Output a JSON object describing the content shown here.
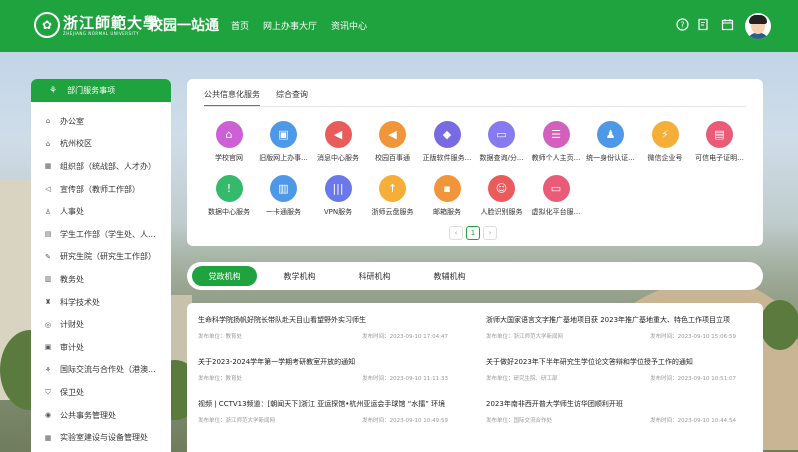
{
  "header": {
    "university_name": "浙江師範大學",
    "university_en": "ZHEJIANG NORMAL UNIVERSITY",
    "portal_title": "校园一站通",
    "nav": [
      "首页",
      "网上办事大厅",
      "资讯中心"
    ],
    "icons": [
      "help-icon",
      "edit-doc-icon",
      "calendar-icon"
    ]
  },
  "sidebar": {
    "title": "部门服务事项",
    "items": [
      {
        "label": "办公室",
        "icon": "home-icon"
      },
      {
        "label": "杭州校区",
        "icon": "campus-icon"
      },
      {
        "label": "组织部（统战部、人才办）",
        "icon": "org-icon"
      },
      {
        "label": "宣传部（教师工作部）",
        "icon": "megaphone-icon"
      },
      {
        "label": "人事处",
        "icon": "person-icon"
      },
      {
        "label": "学生工作部（学生处、人...",
        "icon": "student-icon"
      },
      {
        "label": "研究生院（研究生工作部）",
        "icon": "graduate-icon"
      },
      {
        "label": "教务处",
        "icon": "book-icon"
      },
      {
        "label": "科学技术处",
        "icon": "flask-icon"
      },
      {
        "label": "计财处",
        "icon": "finance-icon"
      },
      {
        "label": "审计处",
        "icon": "audit-icon"
      },
      {
        "label": "国际交流与合作处（港澳...",
        "icon": "globe-icon"
      },
      {
        "label": "保卫处",
        "icon": "shield-icon"
      },
      {
        "label": "公共事务管理处",
        "icon": "public-icon"
      },
      {
        "label": "实验室建设与设备管理处",
        "icon": "lab-icon"
      }
    ]
  },
  "services": {
    "tabs": [
      "公共信息化服务",
      "综合查询"
    ],
    "items": [
      {
        "label": "学校官网",
        "color": "#c84fd0",
        "icon": "school-icon"
      },
      {
        "label": "旧版网上办事...",
        "color": "#3a8ee6",
        "icon": "briefcase-icon"
      },
      {
        "label": "消息中心服务",
        "color": "#e84a4a",
        "icon": "megaphone-icon"
      },
      {
        "label": "校园百事通",
        "color": "#f08a24",
        "icon": "announce-icon"
      },
      {
        "label": "正版软件服务...",
        "color": "#6a5ae0",
        "icon": "cube-icon"
      },
      {
        "label": "数据查询/分...",
        "color": "#7b6cf0",
        "icon": "tv-icon"
      },
      {
        "label": "教师个人主页...",
        "color": "#d04fb8",
        "icon": "profile-icon"
      },
      {
        "label": "统一身份认证...",
        "color": "#3a8ee6",
        "icon": "users-icon"
      },
      {
        "label": "微信企业号",
        "color": "#f5a623",
        "icon": "shield-bolt-icon"
      },
      {
        "label": "可信电子证明...",
        "color": "#e84a6a",
        "icon": "certificate-icon"
      },
      {
        "label": "数据中心服务",
        "color": "#1fb35a",
        "icon": "alert-shield-icon"
      },
      {
        "label": "一卡通服务",
        "color": "#3a8ee6",
        "icon": "card-icon"
      },
      {
        "label": "VPN服务",
        "color": "#5a6ae8",
        "icon": "vpn-icon"
      },
      {
        "label": "浙师云盘服务",
        "color": "#f5a623",
        "icon": "upload-icon"
      },
      {
        "label": "邮箱服务",
        "color": "#f08a24",
        "icon": "save-icon"
      },
      {
        "label": "人脸识别服务",
        "color": "#e84a4a",
        "icon": "face-icon"
      },
      {
        "label": "虚拟化平台服...",
        "color": "#e84a6a",
        "icon": "monitor-icon"
      }
    ],
    "pager": {
      "prev": "‹",
      "current": "1",
      "next": "›"
    }
  },
  "news_tabs": [
    "党政机构",
    "教学机构",
    "科研机构",
    "教辅机构"
  ],
  "news": [
    {
      "title": "生命科学院扬帆好院长带队赴天目山看望野外实习师生",
      "unit": "发布单位：教育处",
      "time": "发布时间：2023-09-10 17:04:47"
    },
    {
      "title": "浙师大国家语言文字推广基地项目获 2023年推广基地重大、特色工作项目立项",
      "unit": "发布单位：浙江师范大学新闻网",
      "time": "发布时间：2023-09-10 15:06:59"
    },
    {
      "title": "关于2023-2024学年第一学期考研教室开放的通知",
      "unit": "发布单位：教育处",
      "time": "发布时间：2023-09-10 11:11:33"
    },
    {
      "title": "关于做好2023年下半年研究生学位论文答辩和学位授予工作的通知",
      "unit": "发布单位：研究生院、研工部",
      "time": "发布时间：2023-09-10 10:51:07"
    },
    {
      "title": "视频 | CCTV13频道：[朝闻天下]浙江 亚运探馆•杭州亚运会手球馆 “水擂” 环境 ...",
      "unit": "发布单位：浙江师范大学新闻网",
      "time": "发布时间：2023-09-10 10:49:59"
    },
    {
      "title": "2023年南非西开普大学师生访华团顺利开班",
      "unit": "发布单位：国际交流合作处",
      "time": "发布时间：2023-09-10 10:44:54"
    }
  ]
}
